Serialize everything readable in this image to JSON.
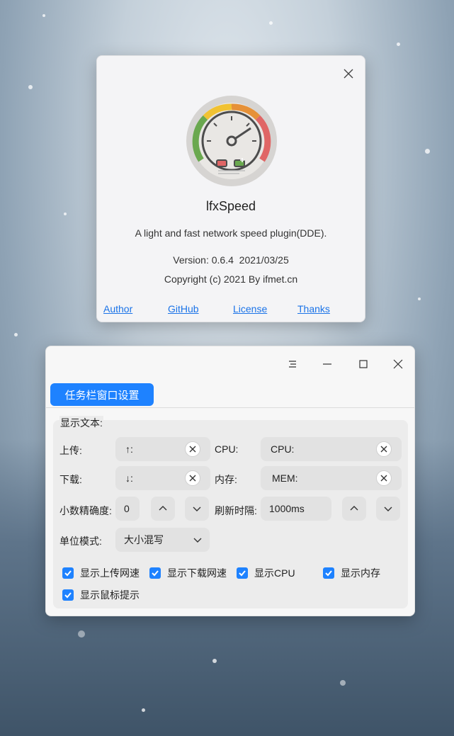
{
  "about": {
    "app_name": "lfxSpeed",
    "description": "A light and fast network speed plugin(DDE).",
    "version_line": "Version: 0.6.4  2021/03/25",
    "copyright": "Copyright (c) 2021 By ifmet.cn",
    "links": [
      "Author",
      "GitHub",
      "License",
      "Thanks"
    ]
  },
  "settings": {
    "tab_label": "任务栏窗口设置",
    "group_label": "显示文本:",
    "upload_label": "上传:",
    "upload_value": "↑:",
    "download_label": "下载:",
    "download_value": "↓:",
    "cpu_label": "CPU:",
    "cpu_value": "CPU:",
    "mem_label": "内存:",
    "mem_value": "MEM:",
    "precision_label": "小数精确度:",
    "precision_value": "0",
    "refresh_label": "刷新时隔:",
    "refresh_value": "1000ms",
    "unit_label": "单位模式:",
    "unit_value": "大小混写",
    "checkboxes": {
      "show_upload": "显示上传网速",
      "show_download": "显示下载网速",
      "show_cpu": "显示CPU",
      "show_mem": "显示内存",
      "show_tooltip": "显示鼠标提示"
    }
  },
  "colors": {
    "accent": "#1e82ff",
    "link": "#1a73e8"
  }
}
